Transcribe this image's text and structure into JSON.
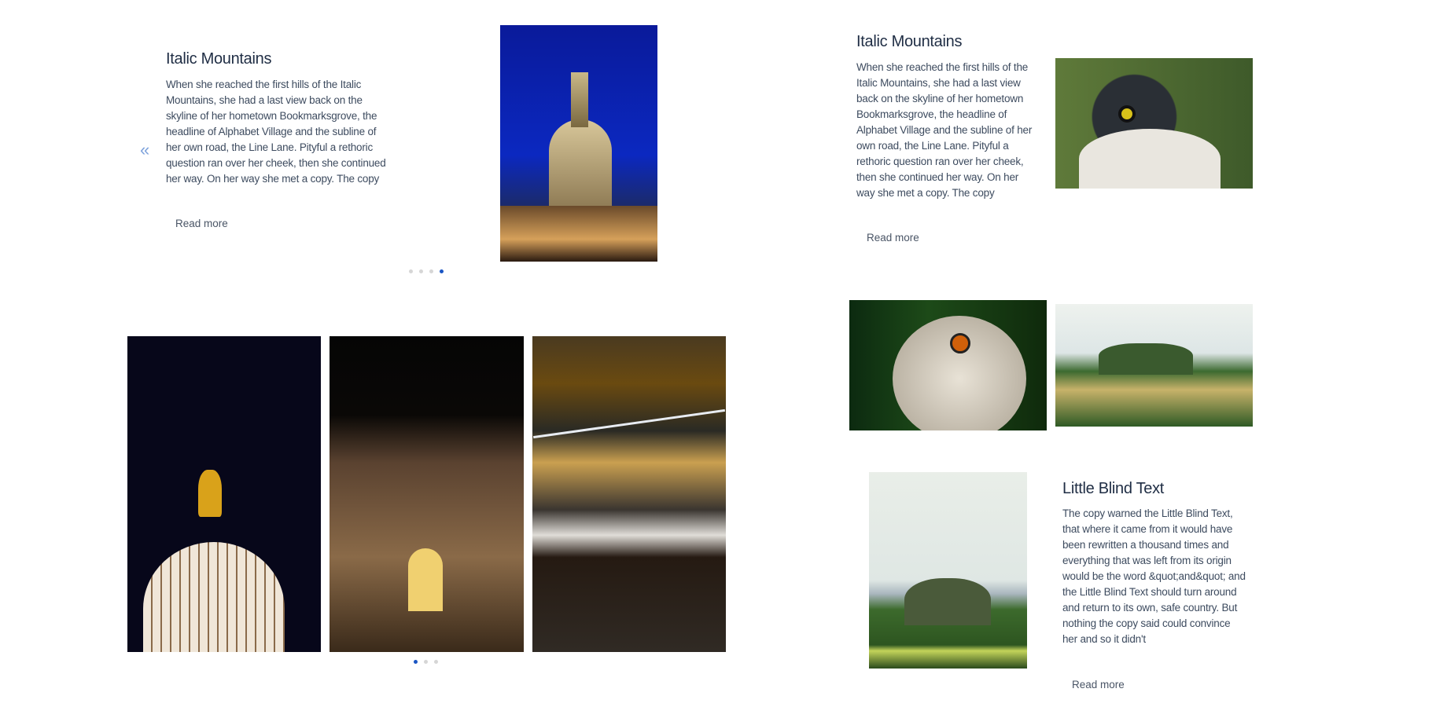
{
  "carousel_top_left": {
    "title": "Italic Mountains",
    "text": "When she reached the first hills of the Italic Mountains, she had a last view back on the skyline of her hometown Bookmarksgrove, the headline of Alphabet Village and the subline of her own road, the Line Lane. Pityful a rethoric question ran over her cheek, then she continued her way. On her way she met a copy. The copy",
    "read_more": "Read more",
    "prev_icon": "«",
    "slides": 4,
    "active_slide": 4
  },
  "card_top_right": {
    "title": "Italic Mountains",
    "text": "When she reached the first hills of the Italic Mountains, she had a last view back on the skyline of her hometown Bookmarksgrove, the headline of Alphabet Village and the subline of her own road, the Line Lane. Pityful a rethoric question ran over her cheek, then she continued her way. On her way she met a copy. The copy",
    "read_more": "Read more"
  },
  "gallery_bottom_left": {
    "slides": 3,
    "active_slide": 1
  },
  "card_bottom_right": {
    "title": "Little Blind Text",
    "text": "The copy warned the Little Blind Text, that where it came from it would have been rewritten a thousand times and everything that was left from its origin would be the word &quot;and&quot; and the Little Blind Text should turn around and return to its own, safe country. But nothing the copy said could convince her and so it didn't",
    "read_more": "Read more"
  },
  "colors": {
    "accent": "#1a56c4",
    "heading": "#1f2d44",
    "body": "#3d4b5f"
  }
}
